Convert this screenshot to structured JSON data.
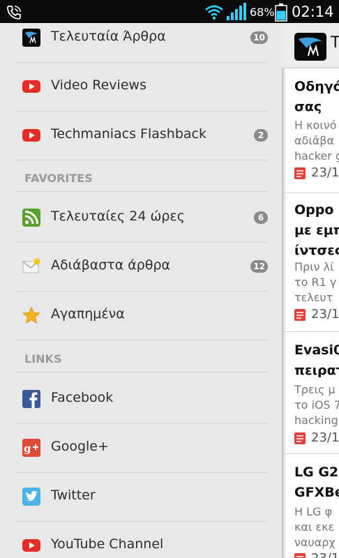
{
  "status_bar": {
    "battery_percent": "68%",
    "time": "02:14",
    "battery_level": 0.68
  },
  "drawer": {
    "items_top": [
      {
        "label": "Τελευταία Άρθρα",
        "count": "10",
        "icon": "techmaniacs-logo-icon"
      },
      {
        "label": "Video Reviews",
        "count": "",
        "icon": "youtube-icon"
      },
      {
        "label": "Techmaniacs Flashback",
        "count": "2",
        "icon": "youtube-icon"
      }
    ],
    "favorites_header": "FAVORITES",
    "favorites": [
      {
        "label": "Τελευταίες 24 ώρες",
        "count": "6",
        "icon": "rss-icon"
      },
      {
        "label": "Αδιάβαστα άρθρα",
        "count": "12",
        "icon": "mail-icon"
      },
      {
        "label": "Αγαπημένα",
        "count": "",
        "icon": "star-icon"
      }
    ],
    "links_header": "LINKS",
    "links": [
      {
        "label": "Facebook",
        "icon": "facebook-icon"
      },
      {
        "label": "Google+",
        "icon": "google-plus-icon"
      },
      {
        "label": "Twitter",
        "icon": "twitter-icon"
      },
      {
        "label": "YouTube Channel",
        "icon": "youtube-icon"
      }
    ]
  },
  "content": {
    "app_title": "T",
    "articles": [
      {
        "title": [
          "Οδηγό",
          "σας"
        ],
        "snippet": [
          "Η κοινό",
          "αδιάβα",
          "hacker g"
        ],
        "date": "23/1"
      },
      {
        "title": [
          "Oppo F",
          "με εμπ",
          "ίντσες"
        ],
        "snippet": [
          "Πριν λί",
          "το R1 γ",
          "τελευτ"
        ],
        "date": "23/1"
      },
      {
        "title": [
          "Evasi0",
          "πειρατ"
        ],
        "snippet": [
          "Τρεις μ",
          "το iOS 7",
          "hacking"
        ],
        "date": "23/1"
      },
      {
        "title": [
          "LG G2",
          "GFXBe"
        ],
        "snippet": [
          "Η LG φ",
          "και εκε",
          "ναυαρχ"
        ],
        "date": "23/1"
      }
    ]
  },
  "colors": {
    "count_badge": "#8a8a8a",
    "date_icon": "#e0413a",
    "youtube": "#e52d27",
    "facebook": "#3b5998",
    "google_plus": "#dd4b39",
    "twitter": "#4ab3e6",
    "rss": "#5aa02c",
    "star": "#f5b21f",
    "battery": "#2fd0ff"
  }
}
